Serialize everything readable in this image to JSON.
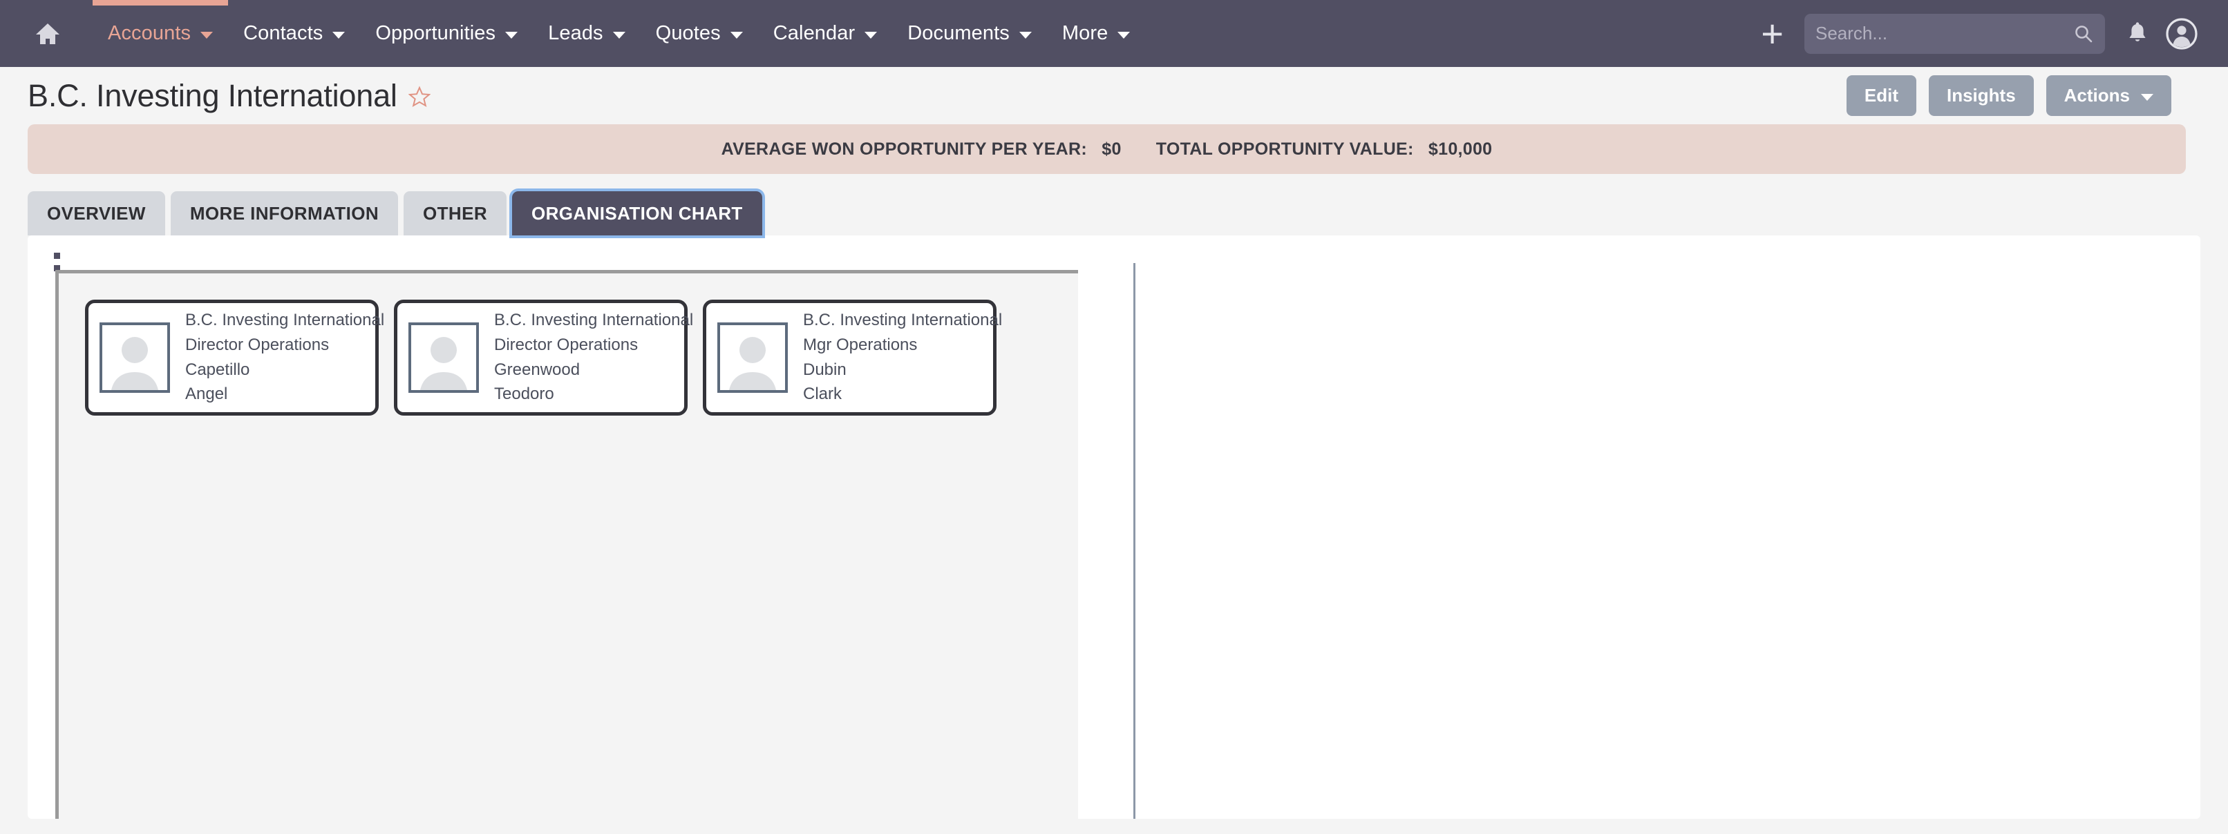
{
  "nav": {
    "home_icon": "home-icon",
    "items": [
      {
        "label": "Accounts",
        "active": true,
        "has_caret": true
      },
      {
        "label": "Contacts",
        "active": false,
        "has_caret": true
      },
      {
        "label": "Opportunities",
        "active": false,
        "has_caret": true
      },
      {
        "label": "Leads",
        "active": false,
        "has_caret": true
      },
      {
        "label": "Quotes",
        "active": false,
        "has_caret": true
      },
      {
        "label": "Calendar",
        "active": false,
        "has_caret": true
      },
      {
        "label": "Documents",
        "active": false,
        "has_caret": true
      },
      {
        "label": "More",
        "active": false,
        "has_caret": true
      }
    ],
    "plus_label": "+",
    "search_placeholder": "Search...",
    "search_value": "",
    "search_icon": "search-icon",
    "bell_icon": "bell-icon",
    "avatar_icon": "user-avatar-icon",
    "accent_color": "#e8a595",
    "bar_color": "#514f63"
  },
  "header": {
    "title": "B.C. Investing International",
    "favorite_icon": "star-outline-icon",
    "favorite_active": false,
    "buttons": [
      {
        "label": "Edit",
        "has_caret": false
      },
      {
        "label": "Insights",
        "has_caret": false
      },
      {
        "label": "Actions",
        "has_caret": true
      }
    ]
  },
  "banner": {
    "background_color": "#e8d5cf",
    "stats": [
      {
        "label": "AVERAGE WON OPPORTUNITY PER YEAR:",
        "value": "$0"
      },
      {
        "label": "TOTAL OPPORTUNITY VALUE:",
        "value": "$10,000"
      }
    ]
  },
  "tabs": [
    {
      "label": "OVERVIEW",
      "active": false
    },
    {
      "label": "MORE INFORMATION",
      "active": false
    },
    {
      "label": "OTHER",
      "active": false
    },
    {
      "label": "ORGANISATION CHART",
      "active": true
    }
  ],
  "org_chart": {
    "drag_handle_icon": "drag-handle-icon",
    "cards": [
      {
        "account": "B.C. Investing International",
        "title": "Director Operations",
        "last_name": "Capetillo",
        "first_name": "Angel",
        "avatar_icon": "person-placeholder-icon"
      },
      {
        "account": "B.C. Investing International",
        "title": "Director Operations",
        "last_name": "Greenwood",
        "first_name": "Teodoro",
        "avatar_icon": "person-placeholder-icon"
      },
      {
        "account": "B.C. Investing International",
        "title": "Mgr Operations",
        "last_name": "Dubin",
        "first_name": "Clark",
        "avatar_icon": "person-placeholder-icon"
      }
    ]
  }
}
